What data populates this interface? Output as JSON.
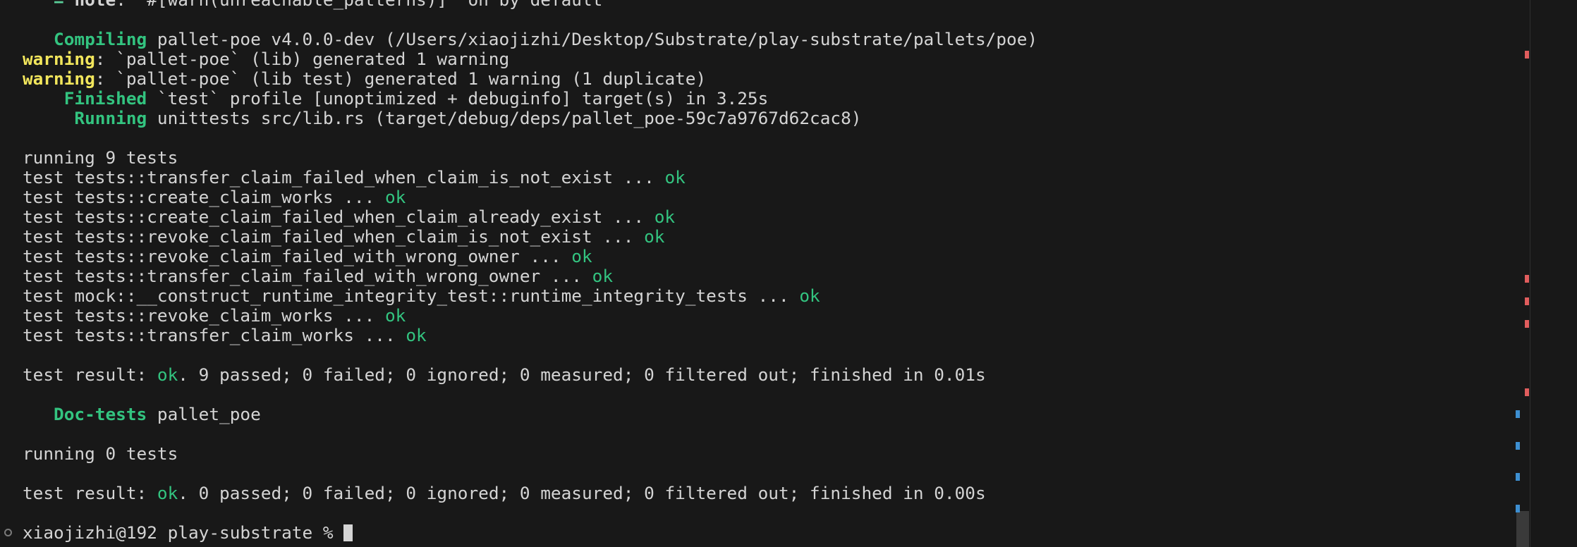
{
  "terminal": {
    "lines": [
      {
        "segments": [
          {
            "text": "   = ",
            "style": "blue-green bold"
          },
          {
            "text": "note",
            "style": "bold"
          },
          {
            "text": ": `#[warn(unreachable_patterns)]` on by default",
            "style": ""
          }
        ]
      },
      {
        "segments": [
          {
            "text": "",
            "style": ""
          }
        ]
      },
      {
        "segments": [
          {
            "text": "   Compiling",
            "style": "green bold"
          },
          {
            "text": " pallet-poe v4.0.0-dev (/Users/xiaojizhi/Desktop/Substrate/play-substrate/pallets/poe)",
            "style": ""
          }
        ]
      },
      {
        "segments": [
          {
            "text": "warning",
            "style": "yellow bold"
          },
          {
            "text": ": `pallet-poe` (lib) generated 1 warning",
            "style": ""
          }
        ]
      },
      {
        "segments": [
          {
            "text": "warning",
            "style": "yellow bold"
          },
          {
            "text": ": `pallet-poe` (lib test) generated 1 warning (1 duplicate)",
            "style": ""
          }
        ]
      },
      {
        "segments": [
          {
            "text": "    Finished",
            "style": "green bold"
          },
          {
            "text": " `test` profile [unoptimized + debuginfo] target(s) in 3.25s",
            "style": ""
          }
        ]
      },
      {
        "segments": [
          {
            "text": "     Running",
            "style": "green bold"
          },
          {
            "text": " unittests src/lib.rs (target/debug/deps/pallet_poe-59c7a9767d62cac8)",
            "style": ""
          }
        ]
      },
      {
        "segments": [
          {
            "text": "",
            "style": ""
          }
        ]
      },
      {
        "segments": [
          {
            "text": "running 9 tests",
            "style": ""
          }
        ]
      },
      {
        "segments": [
          {
            "text": "test tests::transfer_claim_failed_when_claim_is_not_exist ... ",
            "style": ""
          },
          {
            "text": "ok",
            "style": "green"
          }
        ]
      },
      {
        "segments": [
          {
            "text": "test tests::create_claim_works ... ",
            "style": ""
          },
          {
            "text": "ok",
            "style": "green"
          }
        ]
      },
      {
        "segments": [
          {
            "text": "test tests::create_claim_failed_when_claim_already_exist ... ",
            "style": ""
          },
          {
            "text": "ok",
            "style": "green"
          }
        ]
      },
      {
        "segments": [
          {
            "text": "test tests::revoke_claim_failed_when_claim_is_not_exist ... ",
            "style": ""
          },
          {
            "text": "ok",
            "style": "green"
          }
        ]
      },
      {
        "segments": [
          {
            "text": "test tests::revoke_claim_failed_with_wrong_owner ... ",
            "style": ""
          },
          {
            "text": "ok",
            "style": "green"
          }
        ]
      },
      {
        "segments": [
          {
            "text": "test tests::transfer_claim_failed_with_wrong_owner ... ",
            "style": ""
          },
          {
            "text": "ok",
            "style": "green"
          }
        ]
      },
      {
        "segments": [
          {
            "text": "test mock::__construct_runtime_integrity_test::runtime_integrity_tests ... ",
            "style": ""
          },
          {
            "text": "ok",
            "style": "green"
          }
        ]
      },
      {
        "segments": [
          {
            "text": "test tests::revoke_claim_works ... ",
            "style": ""
          },
          {
            "text": "ok",
            "style": "green"
          }
        ]
      },
      {
        "segments": [
          {
            "text": "test tests::transfer_claim_works ... ",
            "style": ""
          },
          {
            "text": "ok",
            "style": "green"
          }
        ]
      },
      {
        "segments": [
          {
            "text": "",
            "style": ""
          }
        ]
      },
      {
        "segments": [
          {
            "text": "test result: ",
            "style": ""
          },
          {
            "text": "ok",
            "style": "green"
          },
          {
            "text": ". 9 passed; 0 failed; 0 ignored; 0 measured; 0 filtered out; finished in 0.01s",
            "style": ""
          }
        ]
      },
      {
        "segments": [
          {
            "text": "",
            "style": ""
          }
        ]
      },
      {
        "segments": [
          {
            "text": "   Doc-tests",
            "style": "green bold"
          },
          {
            "text": " pallet_poe",
            "style": ""
          }
        ]
      },
      {
        "segments": [
          {
            "text": "",
            "style": ""
          }
        ]
      },
      {
        "segments": [
          {
            "text": "running 0 tests",
            "style": ""
          }
        ]
      },
      {
        "segments": [
          {
            "text": "",
            "style": ""
          }
        ]
      },
      {
        "segments": [
          {
            "text": "test result: ",
            "style": ""
          },
          {
            "text": "ok",
            "style": "green"
          },
          {
            "text": ". 0 passed; 0 failed; 0 ignored; 0 measured; 0 filtered out; finished in 0.00s",
            "style": ""
          }
        ]
      },
      {
        "segments": [
          {
            "text": "",
            "style": ""
          }
        ]
      }
    ],
    "prompt": {
      "text": "xiaojizhi@192 play-substrate % "
    }
  },
  "overview_ruler": {
    "red_markers": [
      1,
      2,
      3,
      4,
      5
    ],
    "blue_markers": [
      1,
      2,
      3,
      4,
      5
    ]
  },
  "colors": {
    "background": "#181818",
    "foreground": "#d4d4d4",
    "success": "#33c480",
    "warning": "#f2e65c",
    "error_marker": "#e05d5d",
    "info_marker": "#3d8fd1"
  }
}
